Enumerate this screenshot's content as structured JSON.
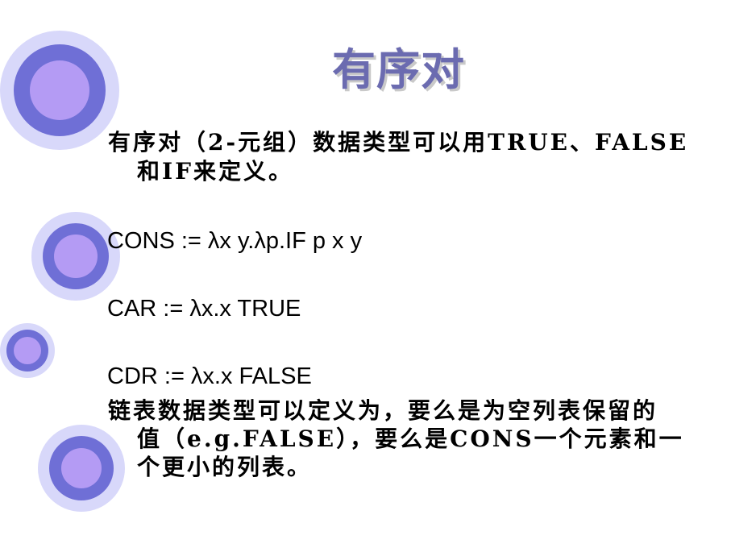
{
  "slide": {
    "title": "有序对",
    "p1_line1": "有序对（2-元组）数据类型可以用TRUE、FALSE",
    "p1_line2": "和IF来定义。",
    "cons_def": "CONS := λx y.λp.IF p x y",
    "car_def": "CAR := λx.x TRUE",
    "cdr_def": "CDR := λx.x FALSE",
    "p2_line1": "链表数据类型可以定义为，要么是为空列表保留的",
    "p2_line2": "值（e.g.FALSE），要么是CONS一个元素和一",
    "p2_line3": "个更小的列表。"
  },
  "colors": {
    "title": "#6b6bb0",
    "circle_outer": "#d8d8fa",
    "circle_mid": "#6f6fd6",
    "circle_inner": "#b49bf4"
  }
}
